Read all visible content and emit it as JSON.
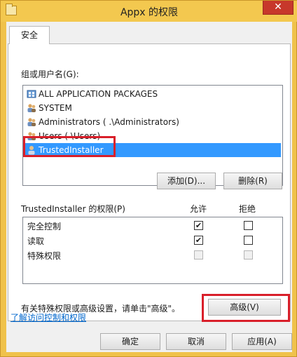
{
  "window": {
    "title": "Appx 的权限",
    "close_glyph": "✕"
  },
  "tab": {
    "label": "安全"
  },
  "groups": {
    "label": "组或用户名(G):",
    "items": [
      {
        "label": "ALL APPLICATION PACKAGES",
        "icon": "packages-icon"
      },
      {
        "label": "SYSTEM",
        "icon": "users-icon"
      },
      {
        "label": "Administrators (        .\\Administrators)",
        "icon": "users-icon"
      },
      {
        "label": "Users (        \\Users)",
        "icon": "users-icon"
      },
      {
        "label": "TrustedInstaller",
        "icon": "user-icon",
        "selected": true
      }
    ]
  },
  "buttons": {
    "add": "添加(D)...",
    "remove": "删除(R)",
    "advanced": "高级(V)",
    "ok": "确定",
    "cancel": "取消",
    "apply": "应用(A)"
  },
  "permissions": {
    "header": "TrustedInstaller 的权限(P)",
    "allow": "允许",
    "deny": "拒绝",
    "rows": [
      {
        "name": "完全控制",
        "allow": true,
        "deny": false,
        "disabled": false
      },
      {
        "name": "读取",
        "allow": true,
        "deny": false,
        "disabled": false
      },
      {
        "name": "特殊权限",
        "allow": false,
        "deny": false,
        "disabled": true
      }
    ]
  },
  "advanced_hint": "有关特殊权限或高级设置，请单击\"高级\"。",
  "learn_link": "了解访问控制和权限",
  "check_glyph": "✔",
  "colors": {
    "selection": "#3399ff",
    "highlight": "#d91f2a",
    "titlebar": "#f3c84f"
  }
}
